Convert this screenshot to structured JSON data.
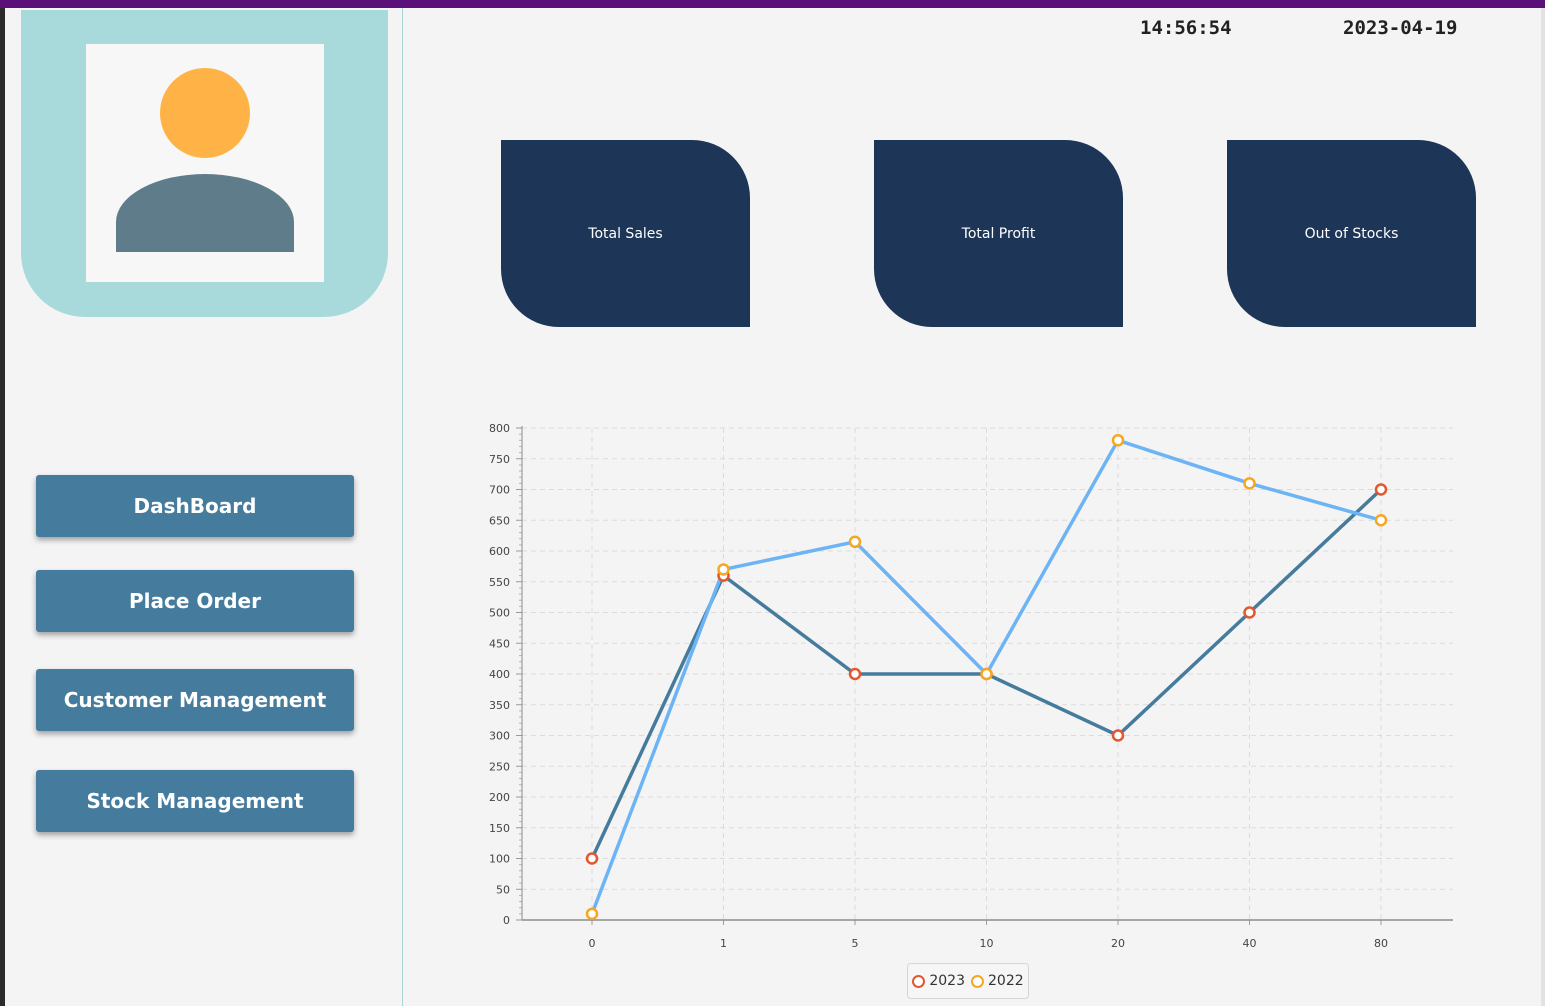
{
  "header": {
    "time": "14:56:54",
    "date": "2023-04-19"
  },
  "sidebar": {
    "profile": {
      "icon": "user-avatar-icon"
    },
    "nav": [
      {
        "label": "DashBoard"
      },
      {
        "label": "Place Order"
      },
      {
        "label": "Customer Management"
      },
      {
        "label": "Stock Management"
      }
    ]
  },
  "cards": [
    {
      "label": "Total Sales"
    },
    {
      "label": "Total Profit"
    },
    {
      "label": "Out of Stocks"
    }
  ],
  "colors": {
    "accent_dark": "#1d3557",
    "button": "#457b9d",
    "profile_bg": "#a8dadb",
    "avatar_head": "#ffb347",
    "avatar_body": "#5f7c8a",
    "series_2023_line": "#457b9d",
    "series_2023_marker": "#e4572e",
    "series_2022_line": "#6cb4f5",
    "series_2022_marker": "#f5a623"
  },
  "chart_data": {
    "type": "line",
    "categories": [
      "0",
      "1",
      "5",
      "10",
      "20",
      "40",
      "80"
    ],
    "series": [
      {
        "name": "2023",
        "values": [
          100,
          560,
          400,
          400,
          300,
          500,
          700
        ]
      },
      {
        "name": "2022",
        "values": [
          10,
          570,
          615,
          400,
          780,
          710,
          650
        ]
      }
    ],
    "ylim": [
      0,
      800
    ],
    "yticks": [
      "0",
      "50",
      "100",
      "150",
      "200",
      "250",
      "300",
      "350",
      "400",
      "450",
      "500",
      "550",
      "600",
      "650",
      "700",
      "750",
      "800"
    ],
    "grid": true,
    "legend": "bottom-center"
  }
}
